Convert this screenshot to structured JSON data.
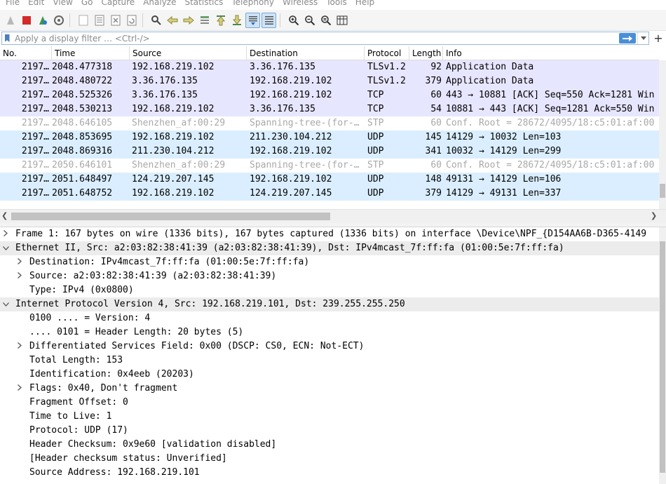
{
  "menu": [
    "File",
    "Edit",
    "View",
    "Go",
    "Capture",
    "Analyze",
    "Statistics",
    "Telephony",
    "Wireless",
    "Tools",
    "Help"
  ],
  "filter": {
    "placeholder": "Apply a display filter … <Ctrl-/>",
    "apply_icon": "arrow-right-icon",
    "dropdown_icon": "chevron-down-icon",
    "plus": "+"
  },
  "columns": [
    "No.",
    "Time",
    "Source",
    "Destination",
    "Protocol",
    "Length",
    "Info"
  ],
  "packets": [
    {
      "no": "2197…",
      "time": "2048.477318",
      "src": "192.168.219.102",
      "dst": "3.36.176.135",
      "proto": "TLSv1.2",
      "len": "92",
      "info": "Application Data",
      "cls": "row-tcp"
    },
    {
      "no": "2197…",
      "time": "2048.480722",
      "src": "3.36.176.135",
      "dst": "192.168.219.102",
      "proto": "TLSv1.2",
      "len": "379",
      "info": "Application Data",
      "cls": "row-tcp"
    },
    {
      "no": "2197…",
      "time": "2048.525326",
      "src": "3.36.176.135",
      "dst": "192.168.219.102",
      "proto": "TCP",
      "len": "60",
      "info": "443 → 10881 [ACK] Seq=550 Ack=1281 Win",
      "cls": "row-tcp"
    },
    {
      "no": "2197…",
      "time": "2048.530213",
      "src": "192.168.219.102",
      "dst": "3.36.176.135",
      "proto": "TCP",
      "len": "54",
      "info": "10881 → 443 [ACK] Seq=1281 Ack=550 Win",
      "cls": "row-tcp"
    },
    {
      "no": "2197…",
      "time": "2048.646105",
      "src": "Shenzhen_af:00:29",
      "dst": "Spanning-tree-(for-…",
      "proto": "STP",
      "len": "60",
      "info": "Conf. Root = 28672/4095/18:c5:01:af:00",
      "cls": "row-stp"
    },
    {
      "no": "2197…",
      "time": "2048.853695",
      "src": "192.168.219.102",
      "dst": "211.230.104.212",
      "proto": "UDP",
      "len": "145",
      "info": "14129 → 10032 Len=103",
      "cls": "row-udp"
    },
    {
      "no": "2197…",
      "time": "2048.869316",
      "src": "211.230.104.212",
      "dst": "192.168.219.102",
      "proto": "UDP",
      "len": "341",
      "info": "10032 → 14129 Len=299",
      "cls": "row-udp"
    },
    {
      "no": "2197…",
      "time": "2050.646101",
      "src": "Shenzhen_af:00:29",
      "dst": "Spanning-tree-(for-…",
      "proto": "STP",
      "len": "60",
      "info": "Conf. Root = 28672/4095/18:c5:01:af:00",
      "cls": "row-stp"
    },
    {
      "no": "2197…",
      "time": "2051.648497",
      "src": "124.219.207.145",
      "dst": "192.168.219.102",
      "proto": "UDP",
      "len": "148",
      "info": "49131 → 14129 Len=106",
      "cls": "row-udp"
    },
    {
      "no": "2197…",
      "time": "2051.648752",
      "src": "192.168.219.102",
      "dst": "124.219.207.145",
      "proto": "UDP",
      "len": "379",
      "info": "14129 → 49131 Len=337",
      "cls": "row-udp"
    }
  ],
  "details": [
    {
      "indent": 0,
      "exp": ">",
      "text": "Frame 1: 167 bytes on wire (1336 bits), 167 bytes captured (1336 bits) on interface \\Device\\NPF_{D154AA6B-D365-4149"
    },
    {
      "indent": 0,
      "exp": "v",
      "text": "Ethernet II, Src: a2:03:82:38:41:39 (a2:03:82:38:41:39), Dst: IPv4mcast_7f:ff:fa (01:00:5e:7f:ff:fa)",
      "hl": true
    },
    {
      "indent": 1,
      "exp": ">",
      "text": "Destination: IPv4mcast_7f:ff:fa (01:00:5e:7f:ff:fa)"
    },
    {
      "indent": 1,
      "exp": ">",
      "text": "Source: a2:03:82:38:41:39 (a2:03:82:38:41:39)"
    },
    {
      "indent": 1,
      "exp": "",
      "text": "Type: IPv4 (0x0800)"
    },
    {
      "indent": 0,
      "exp": "v",
      "text": "Internet Protocol Version 4, Src: 192.168.219.101, Dst: 239.255.255.250",
      "hl": true
    },
    {
      "indent": 1,
      "exp": "",
      "text": "0100 .... = Version: 4"
    },
    {
      "indent": 1,
      "exp": "",
      "text": ".... 0101 = Header Length: 20 bytes (5)"
    },
    {
      "indent": 1,
      "exp": ">",
      "text": "Differentiated Services Field: 0x00 (DSCP: CS0, ECN: Not-ECT)"
    },
    {
      "indent": 1,
      "exp": "",
      "text": "Total Length: 153"
    },
    {
      "indent": 1,
      "exp": "",
      "text": "Identification: 0x4eeb (20203)"
    },
    {
      "indent": 1,
      "exp": ">",
      "text": "Flags: 0x40, Don't fragment"
    },
    {
      "indent": 1,
      "exp": "",
      "text": "Fragment Offset: 0"
    },
    {
      "indent": 1,
      "exp": "",
      "text": "Time to Live: 1"
    },
    {
      "indent": 1,
      "exp": "",
      "text": "Protocol: UDP (17)"
    },
    {
      "indent": 1,
      "exp": "",
      "text": "Header Checksum: 0x9e60 [validation disabled]"
    },
    {
      "indent": 1,
      "exp": "",
      "text": "[Header checksum status: Unverified]"
    },
    {
      "indent": 1,
      "exp": "",
      "text": "Source Address: 192.168.219.101"
    }
  ]
}
